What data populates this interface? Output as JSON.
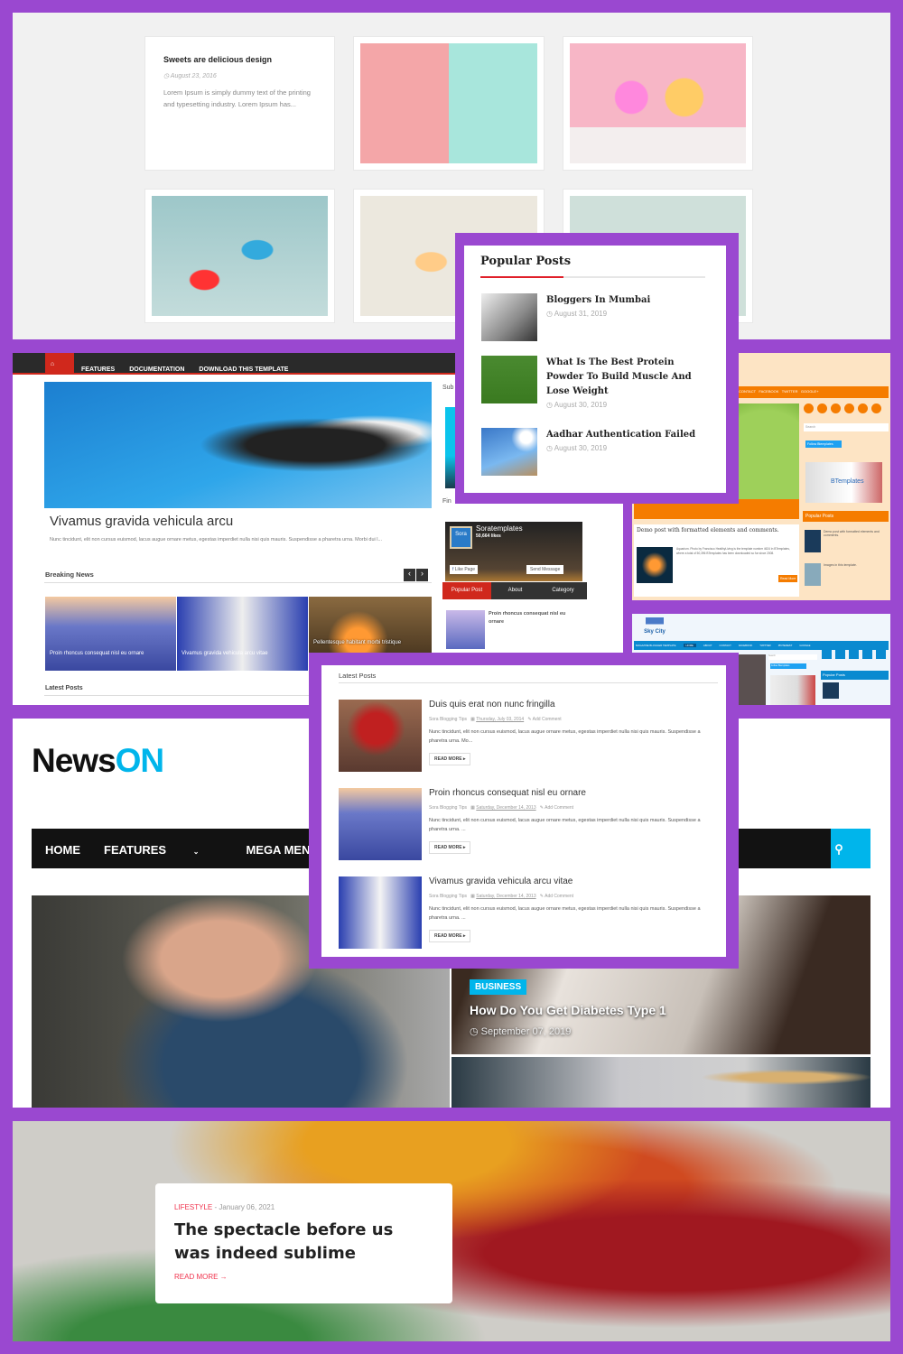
{
  "top_gallery": {
    "card_title": "Sweets are delicious design",
    "card_date": "August 23, 2016",
    "card_excerpt": "Lorem Ipsum is simply dummy text of the printing and typesetting industry. Lorem Ipsum has..."
  },
  "popular_posts": {
    "title": "Popular Posts",
    "items": [
      {
        "title": "Bloggers In Mumbai",
        "date": "August 31, 2019"
      },
      {
        "title": "What Is The Best Protein Powder To Build Muscle And Lose Weight",
        "date": "August 30, 2019"
      },
      {
        "title": "Aadhar Authentication Failed",
        "date": "August 30, 2019"
      }
    ]
  },
  "red_theme": {
    "nav": [
      "FEATURES",
      "DOCUMENTATION",
      "DOWNLOAD THIS TEMPLATE"
    ],
    "hero_title": "Vivamus gravida vehicula arcu",
    "hero_excerpt": "Nunc tincidunt, elit non cursus euismod, lacus augue ornare metus, egestas imperdiet nulla nisi quis mauris. Suspendisse a pharetra urna. Morbi dui l...",
    "breaking_news": "Breaking News",
    "breaking": [
      "Proin rhoncus consequat nisl eu ornare",
      "Vivamus gravida vehicula arcu vitae",
      "Pellentesque habitant morbi tristique"
    ],
    "latest_posts": "Latest Posts",
    "sidebar_sub": "Sub",
    "sidebar_find": "Fin",
    "fb": {
      "name": "Soratemplates",
      "likes": "50,664 likes",
      "like": "Like Page",
      "message": "Send Message",
      "logo": "Sora"
    },
    "tabs": [
      "Popular Post",
      "About",
      "Category"
    ],
    "tab_post": "Proin rhoncus consequat nisl eu ornare"
  },
  "latest_posts": {
    "title": "Latest Posts",
    "read_more": "READ MORE ▸",
    "items": [
      {
        "title": "Duis quis erat non nunc fringilla",
        "label": "Sora Blogging Tips",
        "date": "Thursday, July 03, 2014",
        "comment": "Add Comment",
        "excerpt": "Nunc tincidunt, elit non cursus euismod, lacus augue ornare metus, egestas imperdiet nulla nisi quis mauris. Suspendisse a pharetra urna. Mo..."
      },
      {
        "title": "Proin rhoncus consequat nisl eu ornare",
        "label": "Sora Blogging Tips",
        "date": "Saturday, December 14, 2013",
        "comment": "Add Comment",
        "excerpt": "Nunc tincidunt, elit non cursus euismod, lacus augue ornare metus, egestas imperdiet nulla nisi quis mauris. Suspendisse a pharetra urna. ..."
      },
      {
        "title": "Vivamus gravida vehicula arcu vitae",
        "label": "Sora Blogging Tips",
        "date": "Saturday, December 14, 2013",
        "comment": "Add Comment",
        "excerpt": "Nunc tincidunt, elit non cursus euismod, lacus augue ornare metus, egestas imperdiet nulla nisi quis mauris. Suspendisse a pharetra urna. ..."
      }
    ]
  },
  "orange_theme": {
    "nav": [
      "CONTACT",
      "FACEBOOK",
      "TWITTER",
      "GOOGLE+"
    ],
    "search": "Search",
    "follow": "Follow Btemplates",
    "brand": "BTemplates",
    "popular": "Popular Posts",
    "post_title": "Demo post with formatted elements and comments.",
    "post_excerpt": "Aquarium. Photo by Francisco HealthyLiving is the template number 4624 in BTemplates, where a total of 50,396 BTemplates has been downloaded so far since 2008.",
    "read_more": "Read More",
    "pp": [
      "Demo post with formatted elements and comments.",
      "Images in this template."
    ]
  },
  "skycity": {
    "logo": "Sky City",
    "nav": [
      "MAGAZINE BLOGGER TEMPLATE",
      "HOME",
      "ABOUT",
      "CONTACT",
      "FACEBOOK",
      "TWITTER",
      "PINTEREST",
      "GOOGLE"
    ],
    "search": "Search",
    "follow": "Follow Btemplates",
    "popular": "Popular Posts"
  },
  "newson": {
    "logo_a": "News",
    "logo_b": "ON",
    "nav": [
      "HOME",
      "FEATURES",
      "MEGA MENU"
    ],
    "badge": "BUSINESS",
    "title": "How Do You Get Diabetes Type 1",
    "date": "September 07, 2019",
    "accent": "#00b5eb"
  },
  "lifestyle": {
    "category": "LIFESTYLE",
    "date": "- January 06, 2021",
    "title": "The spectacle before us was indeed sublime",
    "read_more": "READ MORE →",
    "accent": "#f0334d"
  }
}
